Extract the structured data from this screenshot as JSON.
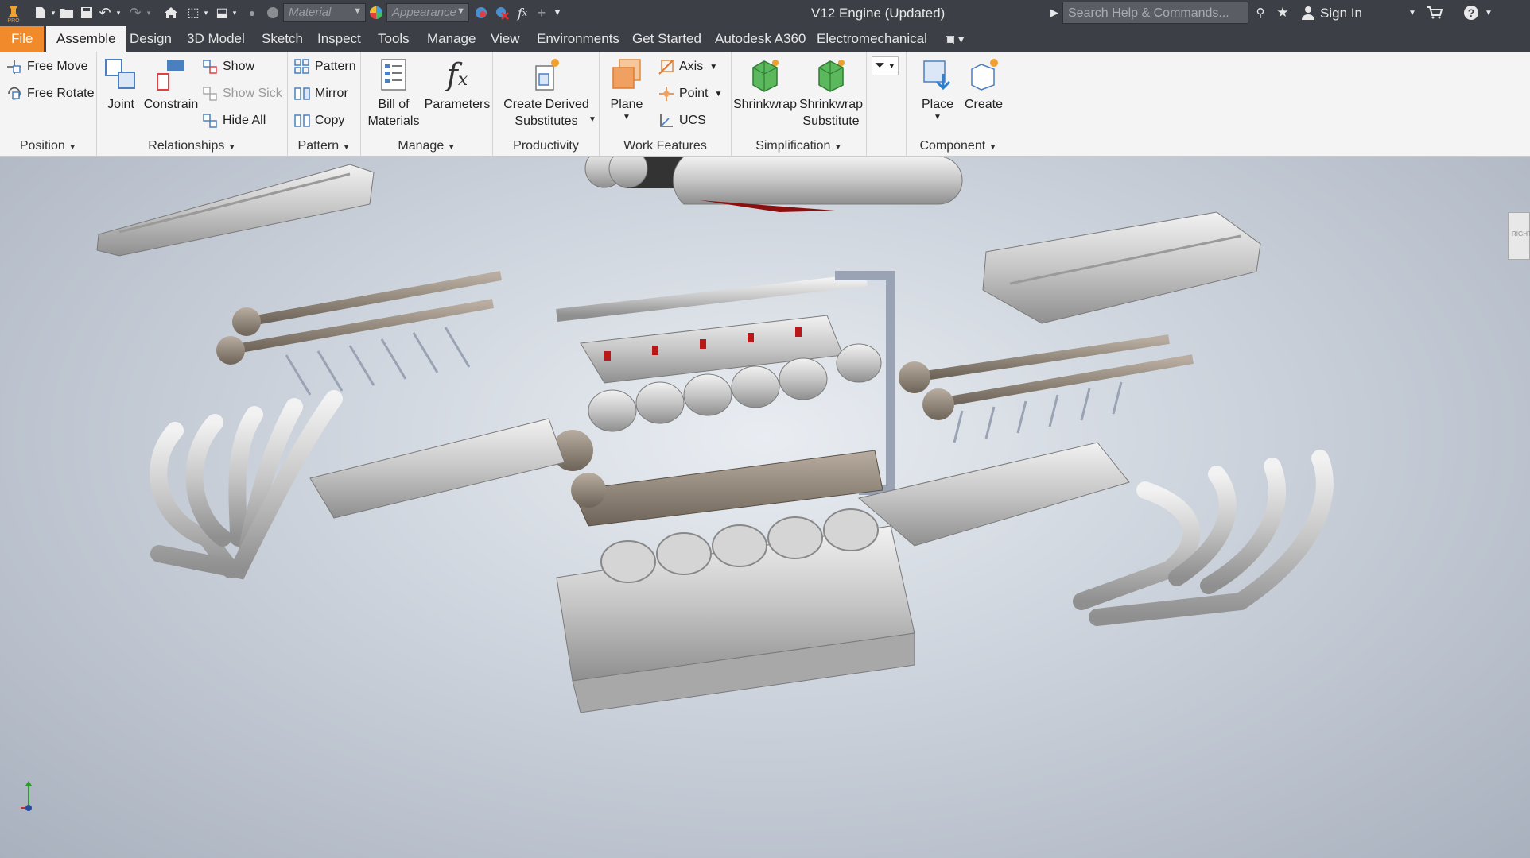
{
  "app": {
    "logo_text": "PRO"
  },
  "titlebar": {
    "material_placeholder": "Material",
    "appearance_placeholder": "Appearance",
    "document_title": "V12 Engine (Updated)",
    "search_placeholder": "Search Help & Commands...",
    "signin_label": "Sign In"
  },
  "tabs": [
    "File",
    "Assemble",
    "Design",
    "3D Model",
    "Sketch",
    "Inspect",
    "Tools",
    "Manage",
    "View",
    "Environments",
    "Get Started",
    "Autodesk A360",
    "Electromechanical"
  ],
  "ribbon": {
    "position": {
      "label": "Position",
      "free_move": "Free Move",
      "free_rotate": "Free Rotate"
    },
    "relationships": {
      "label": "Relationships",
      "joint": "Joint",
      "constrain": "Constrain",
      "show": "Show",
      "show_sick": "Show Sick",
      "hide_all": "Hide All"
    },
    "pattern": {
      "label": "Pattern",
      "pattern": "Pattern",
      "mirror": "Mirror",
      "copy": "Copy"
    },
    "manage": {
      "label": "Manage",
      "bom": "Bill of\nMaterials",
      "parameters": "Parameters"
    },
    "productivity": {
      "label": "Productivity",
      "create_derived": "Create Derived\nSubstitutes"
    },
    "work_features": {
      "label": "Work Features",
      "plane": "Plane",
      "axis": "Axis",
      "point": "Point",
      "ucs": "UCS"
    },
    "simplification": {
      "label": "Simplification",
      "shrinkwrap": "Shrinkwrap",
      "shrinkwrap_sub": "Shrinkwrap\nSubstitute"
    },
    "component": {
      "label": "Component",
      "place": "Place",
      "create": "Create"
    }
  },
  "viewport": {
    "viewcube_label": "RIGHT"
  },
  "colors": {
    "titlebar": "#3c4046",
    "file_tab": "#f08a2a",
    "ribbon": "#f4f4f4"
  }
}
